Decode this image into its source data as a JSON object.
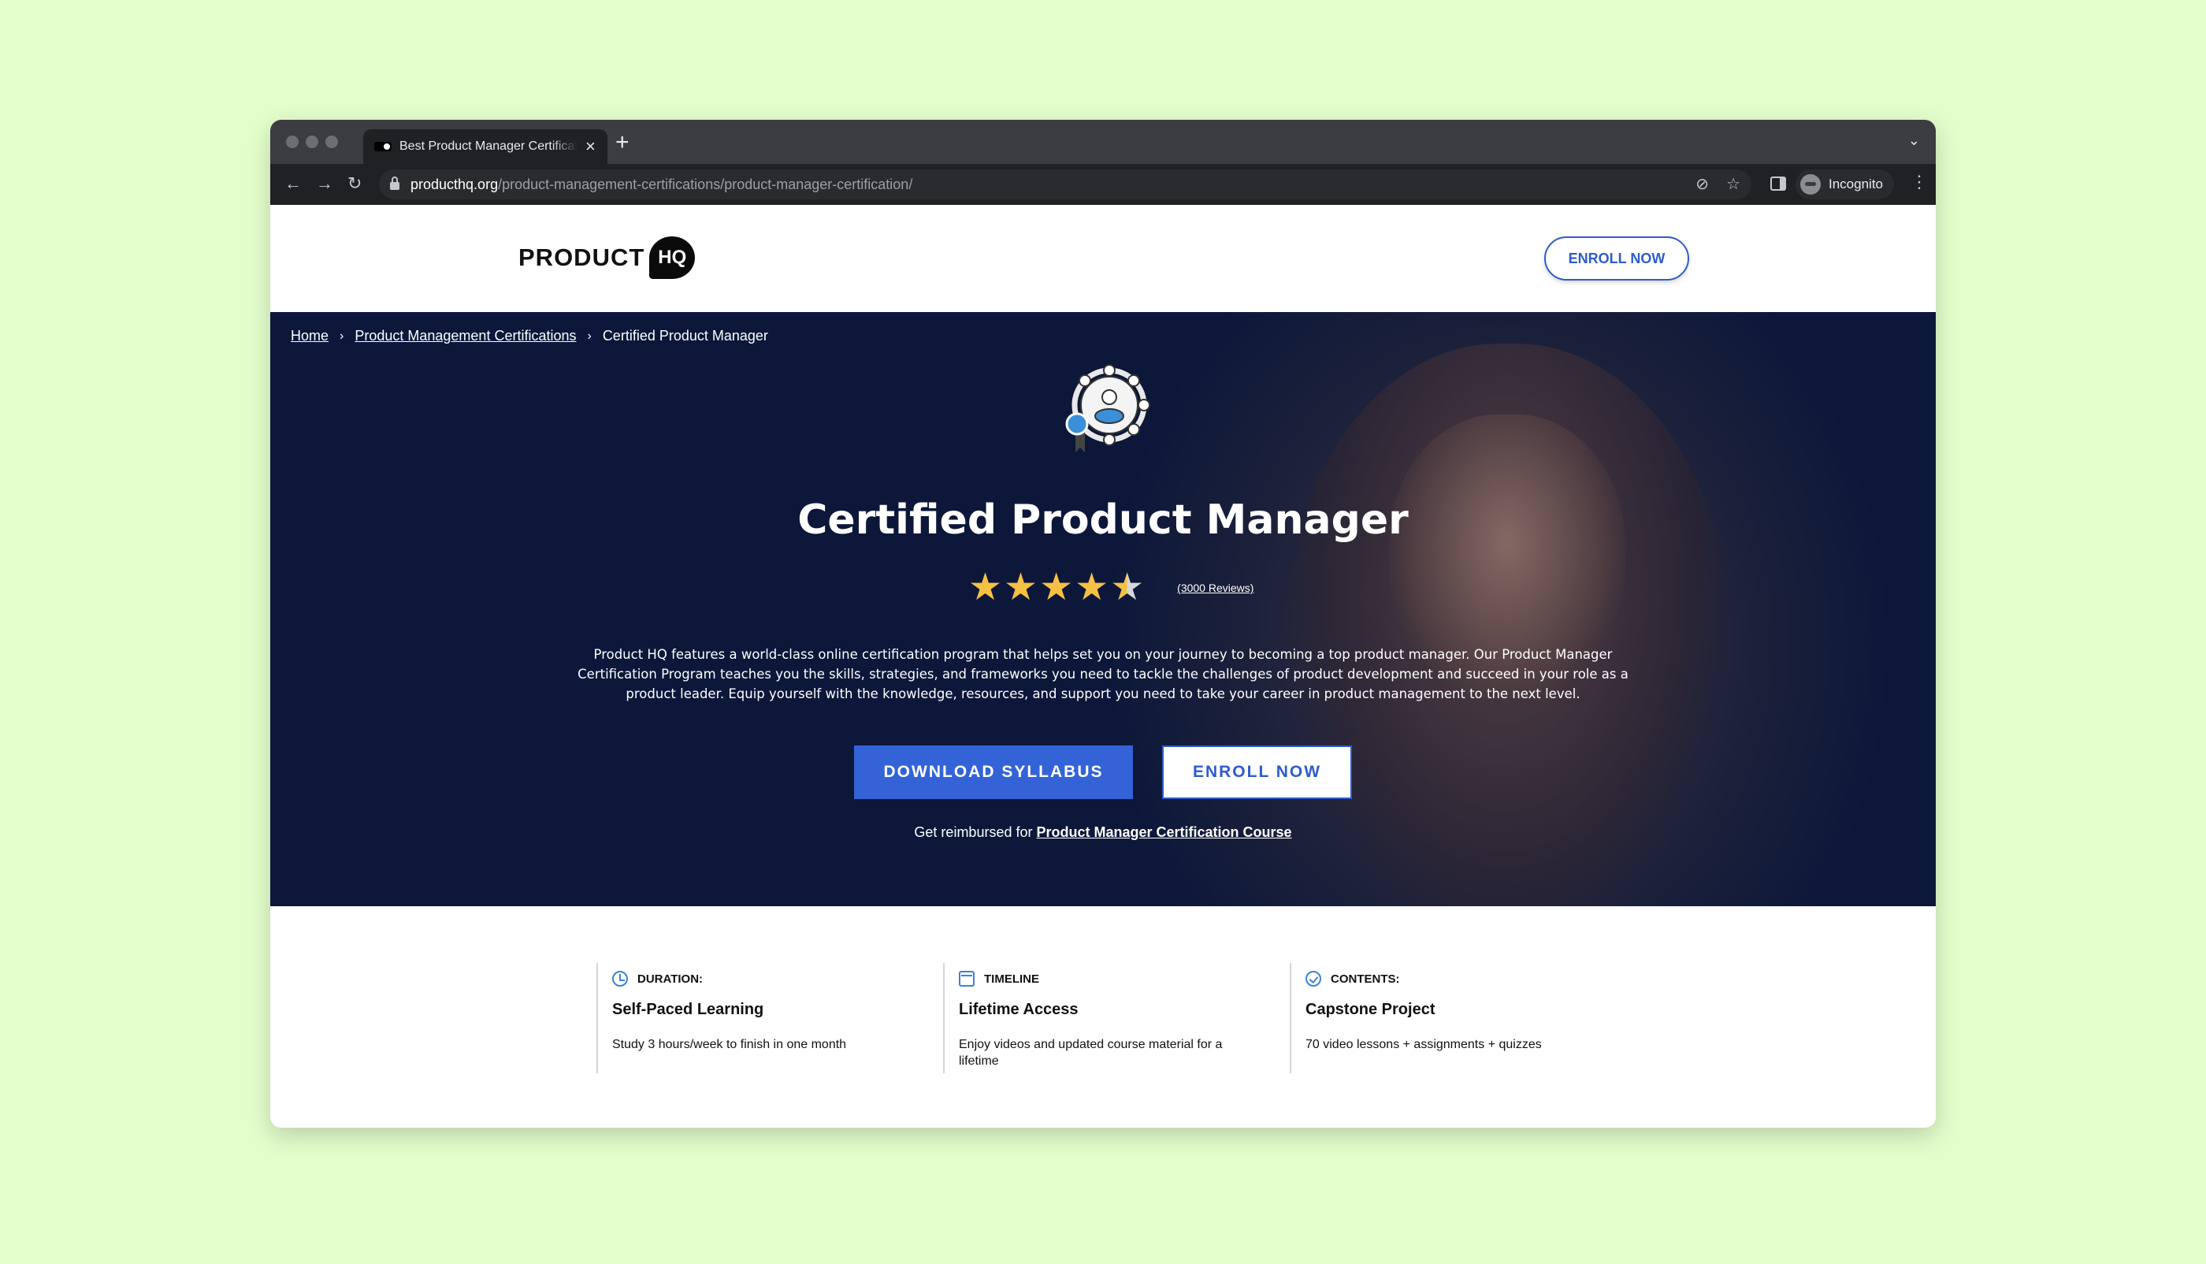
{
  "browser": {
    "tab_title": "Best Product Manager Certification",
    "tab_close": "×",
    "new_tab": "+",
    "tab_menu": "⌄",
    "url_host": "producthq.org",
    "url_path": "/product-management-certifications/product-manager-certification/",
    "profile_label": "Incognito",
    "nav_back": "←",
    "nav_forward": "→",
    "nav_reload": "↻",
    "menu": "⋮",
    "icons": [
      "eye-off-icon",
      "star-icon",
      "side-panel-icon"
    ]
  },
  "header": {
    "logo_text": "PRODUCT",
    "logo_badge": "HQ",
    "enroll_label": "ENROLL NOW"
  },
  "breadcrumb": {
    "items": [
      "Home",
      "Product Management Certifications",
      "Certified Product Manager"
    ],
    "separator": "›"
  },
  "hero": {
    "title": "Certified Product Manager",
    "rating": {
      "value": 4.5,
      "max": 5,
      "reviews_label": "(3000 Reviews)"
    },
    "description": "Product HQ features a world-class online certification program that helps set you on your journey to becoming a top product manager. Our Product Manager Certification Program teaches you the skills, strategies, and frameworks you need to tackle the challenges of product development and succeed in your role as a product leader. Equip yourself with the knowledge, resources, and support you need to take your career in product management to the next level.",
    "download_label": "DOWNLOAD SYLLABUS",
    "enroll_label": "ENROLL NOW",
    "reimburse_prefix": "Get reimbursed for",
    "reimburse_link": "Product Manager Certification Course"
  },
  "features": [
    {
      "icon": "clock-icon",
      "heading": "DURATION:",
      "title": "Self-Paced Learning",
      "desc": "Study 3 hours/week to finish in one month"
    },
    {
      "icon": "calendar-icon",
      "heading": "TIMELINE",
      "title": "Lifetime Access",
      "desc": "Enjoy videos and updated course material for a lifetime"
    },
    {
      "icon": "check-circle-icon",
      "heading": "CONTENTS:",
      "title": "Capstone Project",
      "desc": "70 video lessons + assignments + quizzes"
    }
  ],
  "colors": {
    "accent": "#3363d6",
    "hero_bg": "#0e1838",
    "star": "#f5c044",
    "backdrop": "#e3fdcb"
  }
}
